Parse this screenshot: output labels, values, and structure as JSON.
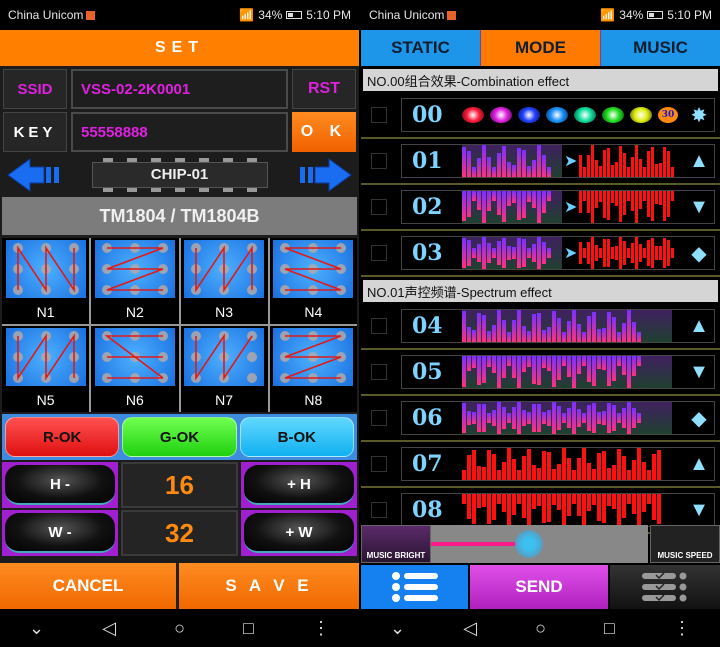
{
  "status_bar": {
    "carrier": "China Unicom",
    "signal": "46",
    "battery": "34%",
    "time": "5:10 PM"
  },
  "left": {
    "title": "SET",
    "ssid_label": "SSID",
    "ssid_value": "VSS-02-2K0001",
    "rst_label": "RST",
    "key_label": "KEY",
    "key_value": "55558888",
    "ok_label": "O K",
    "chip_label": "CHIP-01",
    "chip_model": "TM1804 / TM1804B",
    "patterns": [
      "N1",
      "N2",
      "N3",
      "N4",
      "N5",
      "N6",
      "N7",
      "N8"
    ],
    "rgb": {
      "r": "R-OK",
      "g": "G-OK",
      "b": "B-OK"
    },
    "h_minus": "H -",
    "h_plus": "+ H",
    "h_value": "16",
    "w_minus": "W -",
    "w_plus": "+ W",
    "w_value": "32",
    "cancel": "CANCEL",
    "save": "S A V E",
    "colors": {
      "accent": "#ff7f00",
      "ssid_text": "#e020e0",
      "value_text": "#ff8a10"
    }
  },
  "right": {
    "tabs": [
      {
        "label": "STATIC"
      },
      {
        "label": "MODE",
        "active": true
      },
      {
        "label": "MUSIC"
      }
    ],
    "section_combination": "NO.00组合效果-Combination effect",
    "section_spectrum": "NO.01声控频谱-Spectrum effect",
    "combination_rows": [
      {
        "num": "00",
        "type": "colors",
        "badge": "30",
        "icon": "star-burst-icon"
      },
      {
        "num": "01",
        "type": "spectrum-transform",
        "icon": "arrow-up-icon"
      },
      {
        "num": "02",
        "type": "spectrum-transform",
        "icon": "arrow-down-icon"
      },
      {
        "num": "03",
        "type": "spectrum-transform",
        "icon": "arrow-updown-icon"
      }
    ],
    "spectrum_rows": [
      {
        "num": "04",
        "type": "purple",
        "icon": "arrow-up-icon"
      },
      {
        "num": "05",
        "type": "purple-down",
        "icon": "arrow-down-icon"
      },
      {
        "num": "06",
        "type": "purple-mid",
        "icon": "arrow-updown-icon"
      },
      {
        "num": "07",
        "type": "red",
        "icon": "arrow-up-icon"
      },
      {
        "num": "08",
        "type": "red-down",
        "icon": "arrow-down-icon"
      }
    ],
    "color_dots": [
      "#ff1a3a",
      "#e020e0",
      "#2040ff",
      "#1890ff",
      "#10e0a0",
      "#20e020",
      "#e0f010"
    ],
    "music_bright_label": "MUSIC BRIGHT",
    "music_speed_label": "MUSIC SPEED",
    "slider_value_percent": 45,
    "send": "SEND"
  },
  "nav": {
    "down": "⌄",
    "back": "◁",
    "home": "○",
    "recent": "□",
    "menu": "⋮"
  }
}
